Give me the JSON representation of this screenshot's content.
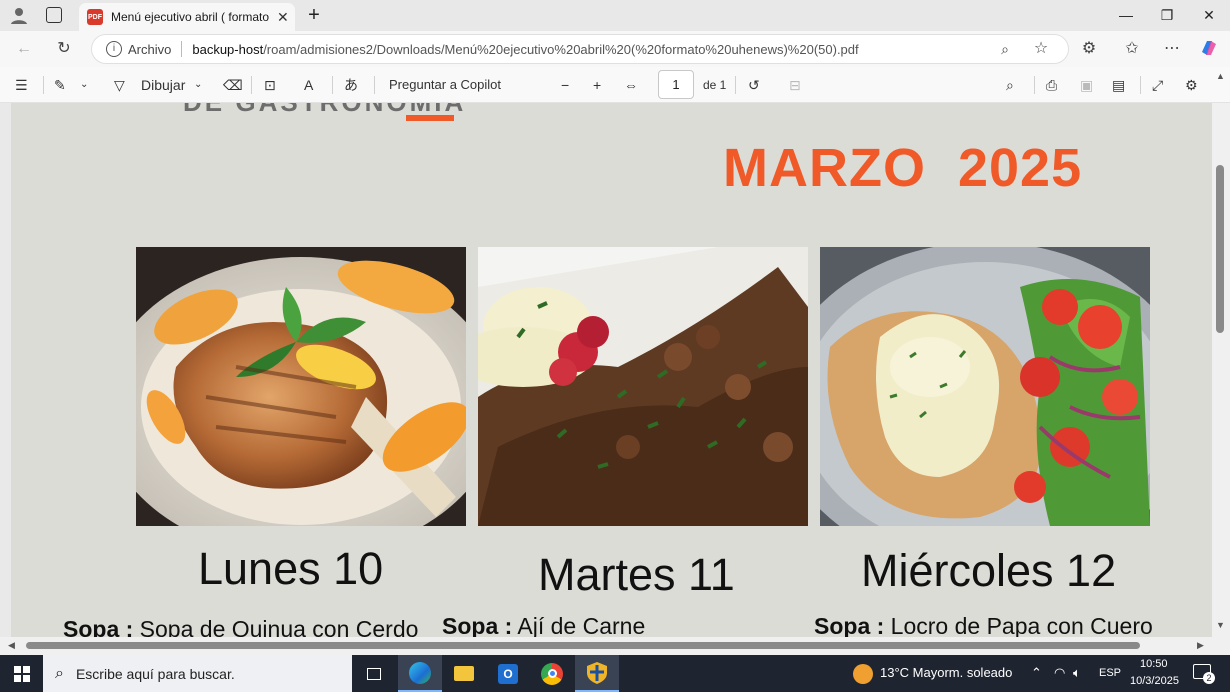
{
  "browser": {
    "tab_title": "Menú ejecutivo abril ( formato uh",
    "address_label": "Archivo",
    "url_host": "backup-host",
    "url_path": "/roam/admisiones2/Downloads/Menú%20ejecutivo%20abril%20(%20formato%20uhenews)%20(50).pdf"
  },
  "pdf_toolbar": {
    "draw_label": "Dibujar",
    "copilot_label": "Preguntar a Copilot",
    "page_current": "1",
    "page_total": "de 1"
  },
  "document": {
    "title_cut": "DE GASTRONOMIA",
    "month": "MARZO  2025",
    "days": [
      {
        "label": "Lunes 10",
        "sopa_key": "Sopa :",
        "sopa": "Sopa de Quinua con Cerdo"
      },
      {
        "label": "Martes 11",
        "sopa_key": "Sopa :",
        "sopa": "Ají de Carne"
      },
      {
        "label": "Miércoles 12",
        "sopa_key": "Sopa :",
        "sopa": "Locro de Papa con Cuero"
      }
    ]
  },
  "taskbar": {
    "search_placeholder": "Escribe aquí para buscar.",
    "weather": "13°C  Mayorm. soleado",
    "lang": "ESP",
    "time": "10:50",
    "date": "10/3/2025",
    "notifications": "2"
  },
  "colors": {
    "accent": "#f05a28",
    "page_bg": "#dcdcd7"
  }
}
